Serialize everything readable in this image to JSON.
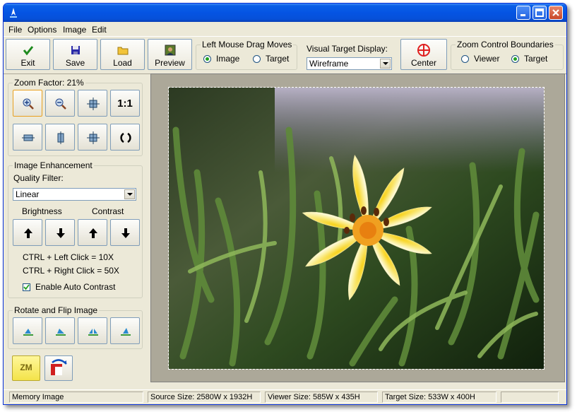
{
  "menu": [
    "File",
    "Options",
    "Image",
    "Edit"
  ],
  "toolbar": {
    "exit_label": "Exit",
    "save_label": "Save",
    "load_label": "Load",
    "preview_label": "Preview",
    "center_label": "Center"
  },
  "drag_group": {
    "legend": "Left Mouse Drag Moves",
    "options": [
      "Image",
      "Target"
    ],
    "selected": "Image"
  },
  "visual_target": {
    "legend": "Visual Target Display:",
    "value": "Wireframe"
  },
  "zoom_boundaries": {
    "legend": "Zoom Control Boundaries",
    "options": [
      "Viewer",
      "Target"
    ],
    "selected": "Target"
  },
  "zoom": {
    "legend": "Zoom Factor: 21%",
    "one_to_one": "1:1"
  },
  "enhancement": {
    "legend": "Image Enhancement",
    "quality_label": "Quality Filter:",
    "quality_value": "Linear",
    "brightness_label": "Brightness",
    "contrast_label": "Contrast",
    "hint1": "CTRL + Left Click = 10X",
    "hint2": "CTRL + Right Click = 50X",
    "auto_contrast_label": "Enable Auto Contrast",
    "auto_contrast_checked": true
  },
  "rotate": {
    "legend": "Rotate and Flip Image"
  },
  "logo_text": "ZM",
  "status": {
    "source": "Memory Image",
    "source_size": "Source Size: 2580W x 1932H",
    "viewer_size": "Viewer Size: 585W x 435H",
    "target_size": "Target Size: 533W x 400H",
    "extra": ""
  },
  "colors": {
    "title_bar": "#0554e3",
    "window_bg": "#ece9d8",
    "viewer_bg": "#aca899",
    "exit_icon": "#1e8a1e",
    "center_icon": "#e02020"
  }
}
